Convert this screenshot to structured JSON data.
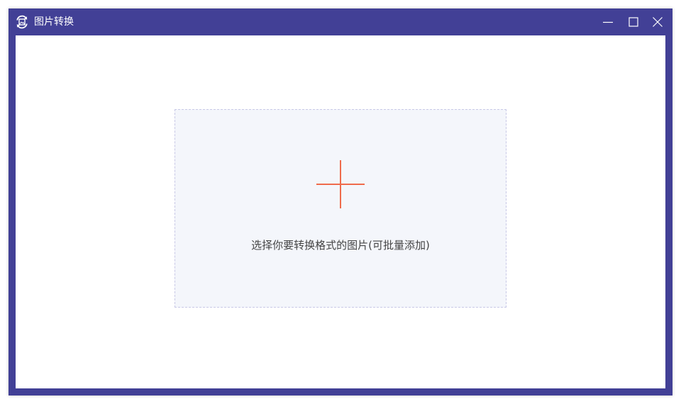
{
  "window": {
    "title": "图片转换",
    "accent_color": "#424096",
    "icon": "image-convert-icon"
  },
  "titlebar_buttons": {
    "minimize": "minimize-icon",
    "maximize": "maximize-icon",
    "close": "close-icon"
  },
  "dropzone": {
    "icon": "plus-icon",
    "icon_color": "#ef6b4c",
    "label": "选择你要转换格式的图片(可批量添加)"
  }
}
